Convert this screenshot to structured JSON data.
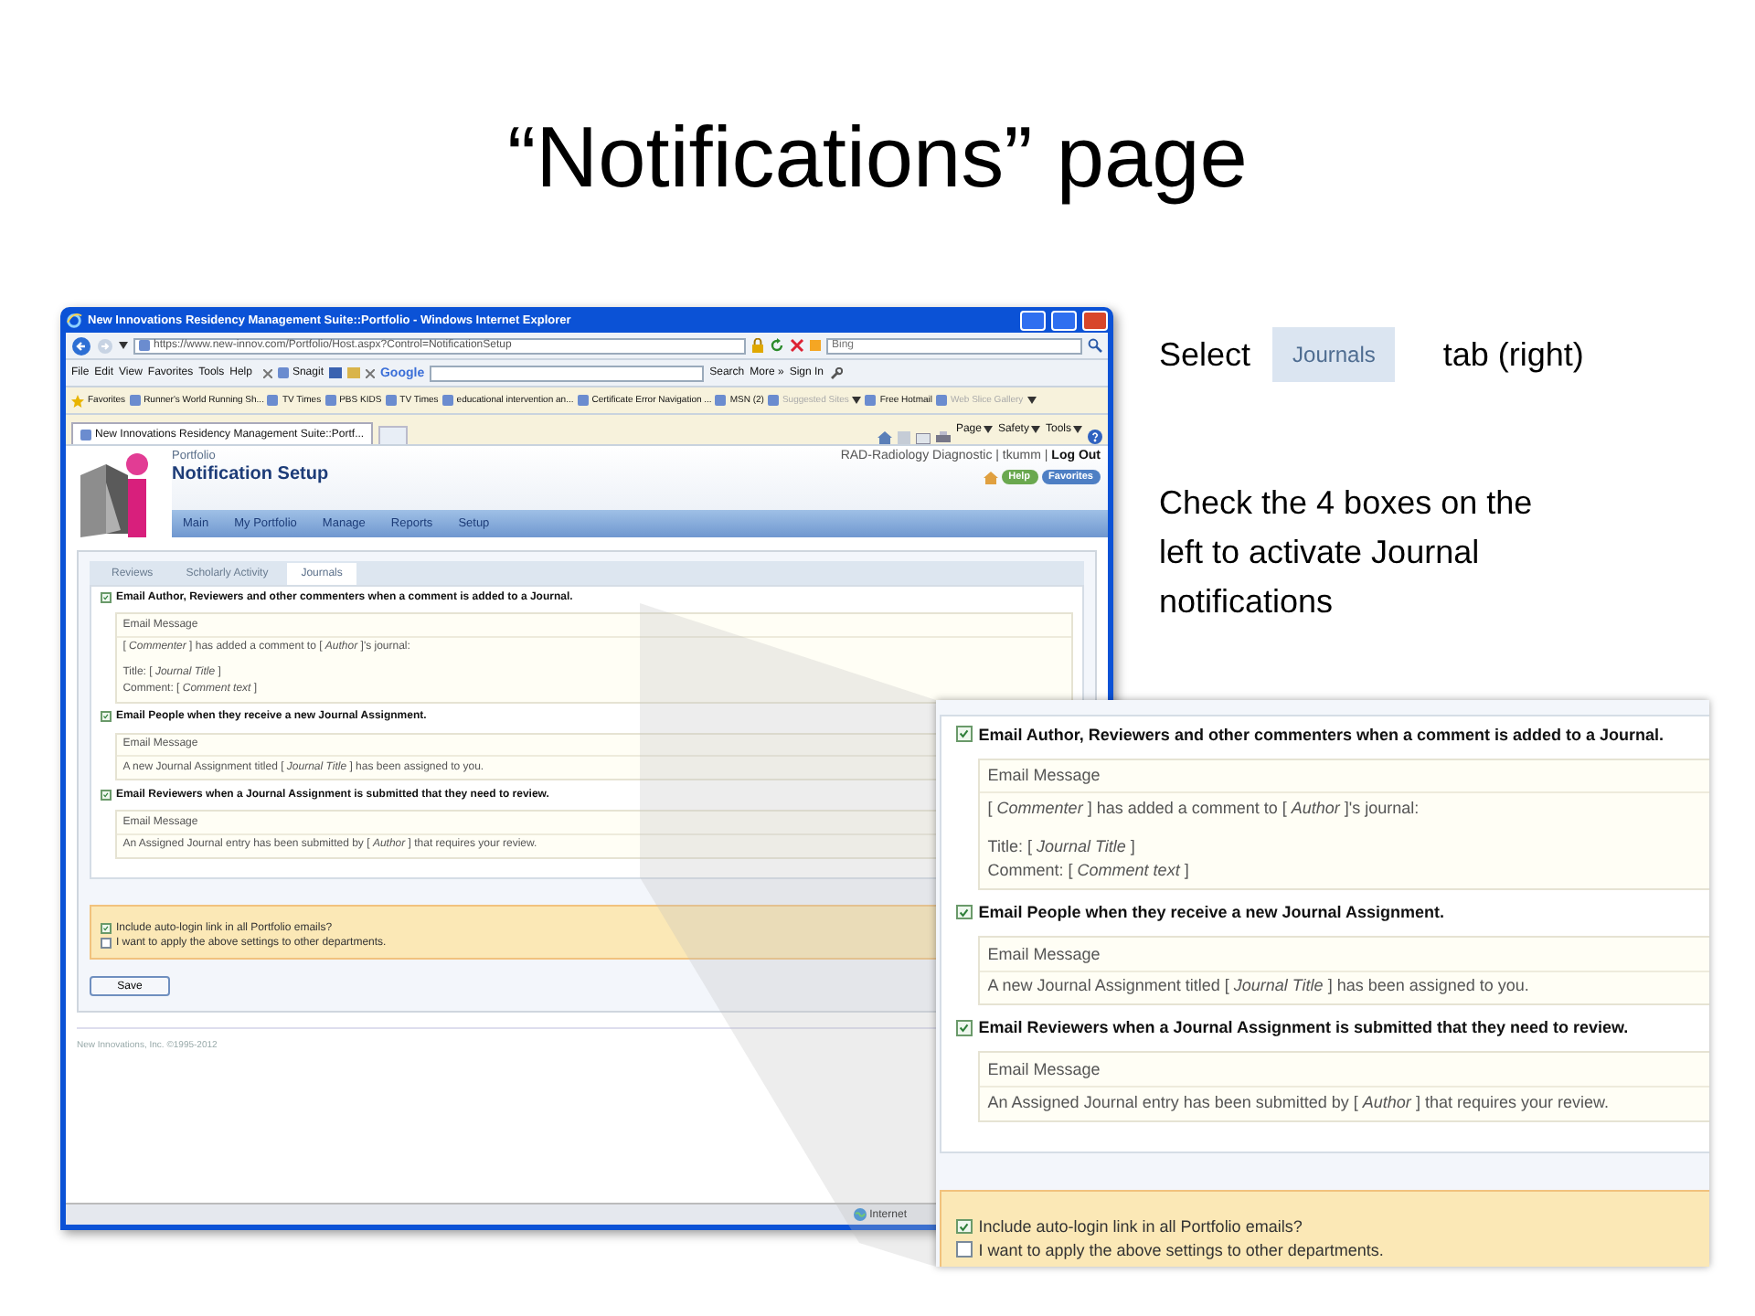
{
  "slide_title": "“Notifications” page",
  "callout": {
    "before_tab": "Select",
    "tab_label": "Journals",
    "after_tab": "tab (right)",
    "instruction": "Check the 4 boxes on the left to activate Journal notifications"
  },
  "browser": {
    "title": "New Innovations Residency Management Suite::Portfolio - Windows Internet Explorer",
    "address": "https://www.new-innov.com/Portfolio/Host.aspx?Control=NotificationSetup",
    "search_placeholder": "Bing",
    "menu": [
      "File",
      "Edit",
      "View",
      "Favorites",
      "Tools",
      "Help"
    ],
    "snagit": "Snagit",
    "google": "Google",
    "search_button": "Search",
    "more": "More »",
    "sign_in": "Sign In",
    "favorites_label": "Favorites",
    "favorites": [
      {
        "label": "Runner's World Running Sh...",
        "dropdown": false,
        "disabled": false
      },
      {
        "label": "TV Times",
        "dropdown": false,
        "disabled": false
      },
      {
        "label": "PBS KIDS",
        "dropdown": false,
        "disabled": false
      },
      {
        "label": "TV Times",
        "dropdown": false,
        "disabled": false
      },
      {
        "label": "educational intervention an...",
        "dropdown": false,
        "disabled": false
      },
      {
        "label": "Certificate Error Navigation ...",
        "dropdown": false,
        "disabled": false
      },
      {
        "label": "MSN (2)",
        "dropdown": false,
        "disabled": false
      },
      {
        "label": "Suggested Sites",
        "dropdown": true,
        "disabled": true
      },
      {
        "label": "Free Hotmail",
        "dropdown": false,
        "disabled": false
      },
      {
        "label": "Web Slice Gallery",
        "dropdown": true,
        "disabled": true
      }
    ],
    "tab": "New Innovations Residency Management Suite::Portf...",
    "commands": [
      "Page",
      "Safety",
      "Tools"
    ],
    "status": "Internet",
    "page": {
      "section": "Portfolio",
      "title": "Notification Setup",
      "user": "RAD-Radiology Diagnostic | tkumm |",
      "logout": "Log Out",
      "help": "Help",
      "favorites": "Favorites",
      "nav": [
        "Main",
        "My Portfolio",
        "Manage",
        "Reports",
        "Setup"
      ],
      "tabs": [
        {
          "label": "Reviews",
          "selected": false
        },
        {
          "label": "Scholarly Activity",
          "selected": false
        },
        {
          "label": "Journals",
          "selected": true
        }
      ],
      "notifications": [
        {
          "label": "Email Author, Reviewers and other commenters when a comment is added to a Journal.",
          "checked": true,
          "message_header": "Email Message",
          "paragraphs": [
            [
              "[ *Commenter* ] has added a comment to [ *Author* ]'s journal:"
            ],
            [
              "Title: [ *Journal Title* ]",
              "Comment: [ *Comment text* ]"
            ]
          ]
        },
        {
          "label": "Email People when they receive a new Journal Assignment.",
          "checked": true,
          "message_header": "Email Message",
          "paragraphs": [
            [
              "A new Journal Assignment titled [ *Journal Title* ] has been assigned to you."
            ]
          ]
        },
        {
          "label": "Email Reviewers when a Journal Assignment is submitted that they need to review.",
          "checked": true,
          "message_header": "Email Message",
          "paragraphs": [
            [
              "An Assigned Journal entry has been submitted by [ *Author* ] that requires your review."
            ]
          ]
        }
      ],
      "options": [
        {
          "label": "Include auto-login link in all Portfolio emails?",
          "checked": true
        },
        {
          "label": "I want to apply the above settings to other departments.",
          "checked": false
        }
      ],
      "save": "Save",
      "footer": "New Innovations, Inc. ©1995-2012"
    }
  },
  "zoom_inset": {
    "notifications": [
      {
        "label": "Email Author, Reviewers and other commenters when a comment is added to a Journal.",
        "checked": true,
        "message_header": "Email Message",
        "paragraphs": [
          [
            "[ *Commenter* ] has added a comment to [ *Author* ]'s journal:"
          ],
          [
            "Title: [ *Journal Title* ]",
            "Comment: [ *Comment text* ]"
          ]
        ]
      },
      {
        "label": "Email People when they receive a new Journal Assignment.",
        "checked": true,
        "message_header": "Email Message",
        "paragraphs": [
          [
            "A new Journal Assignment titled [ *Journal Title* ] has been assigned to you."
          ]
        ]
      },
      {
        "label": "Email Reviewers when a Journal Assignment is submitted that they need to review.",
        "checked": true,
        "message_header": "Email Message",
        "paragraphs": [
          [
            "An Assigned Journal entry has been submitted by [ *Author* ] that requires your review."
          ]
        ]
      }
    ],
    "options": [
      {
        "label": "Include auto-login link in all Portfolio emails?",
        "checked": true
      },
      {
        "label": "I want to apply the above settings to other departments.",
        "checked": false
      }
    ]
  }
}
